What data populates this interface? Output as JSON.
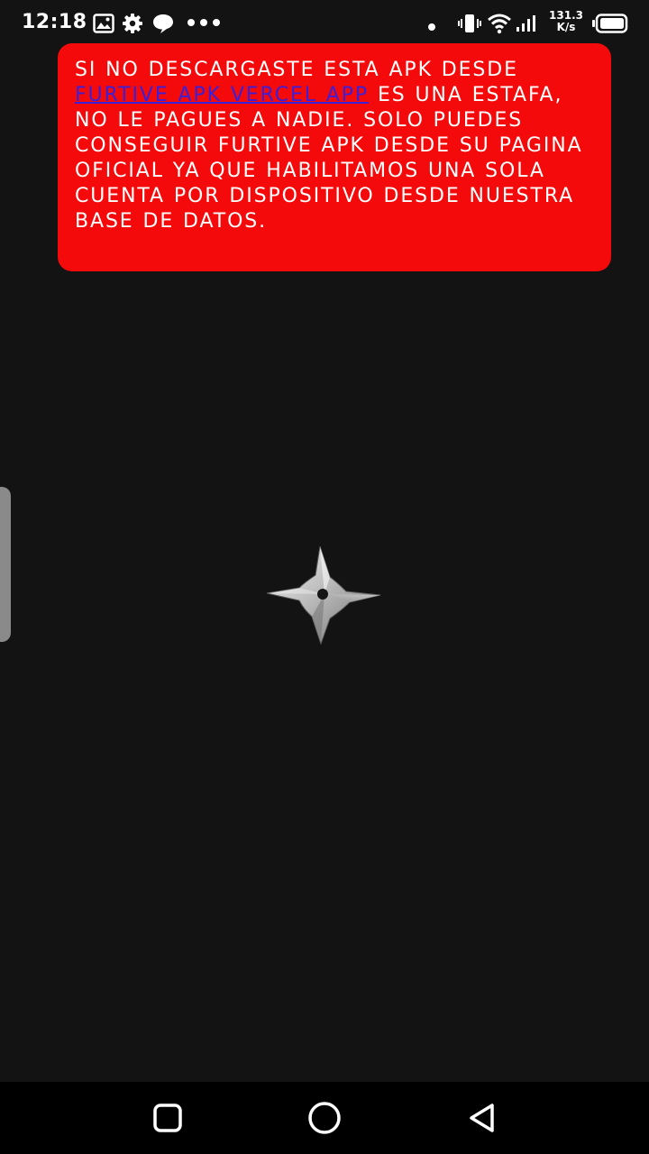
{
  "status_bar": {
    "time": "12:18",
    "left_icons": [
      "gallery-icon",
      "gear-icon",
      "chat-icon",
      "more-dots-icon"
    ],
    "right_icons": [
      "dot-icon",
      "vibrate-icon",
      "wifi-icon",
      "signal-icon",
      "battery-icon"
    ],
    "net_speed_value": "131.3",
    "net_speed_unit": "K/s"
  },
  "warning": {
    "text_before_link": "SI NO DESCARGASTE ESTA APK DESDE ",
    "link_text": "FURTIVE APK VERCEL APP",
    "text_after_link": " ES UNA ESTAFA, NO LE PAGUES A NADIE. SOLO PUEDES CONSEGUIR FURTIVE APK DESDE SU PAGINA OFICIAL YA QUE HABILITAMOS UNA SOLA CUENTA POR DISPOSITIVO DESDE NUESTRA BASE DE DATOS.",
    "background_color": "#f40a0a",
    "link_color": "#3b1fd9"
  },
  "loading_indicator": {
    "icon": "shuriken-icon"
  },
  "side_handle": {
    "icon": "edge-panel-handle"
  },
  "nav_bar": {
    "buttons": [
      "recent-apps-button",
      "home-button",
      "back-button"
    ]
  },
  "colors": {
    "background": "#131313",
    "nav_background": "#000000"
  }
}
